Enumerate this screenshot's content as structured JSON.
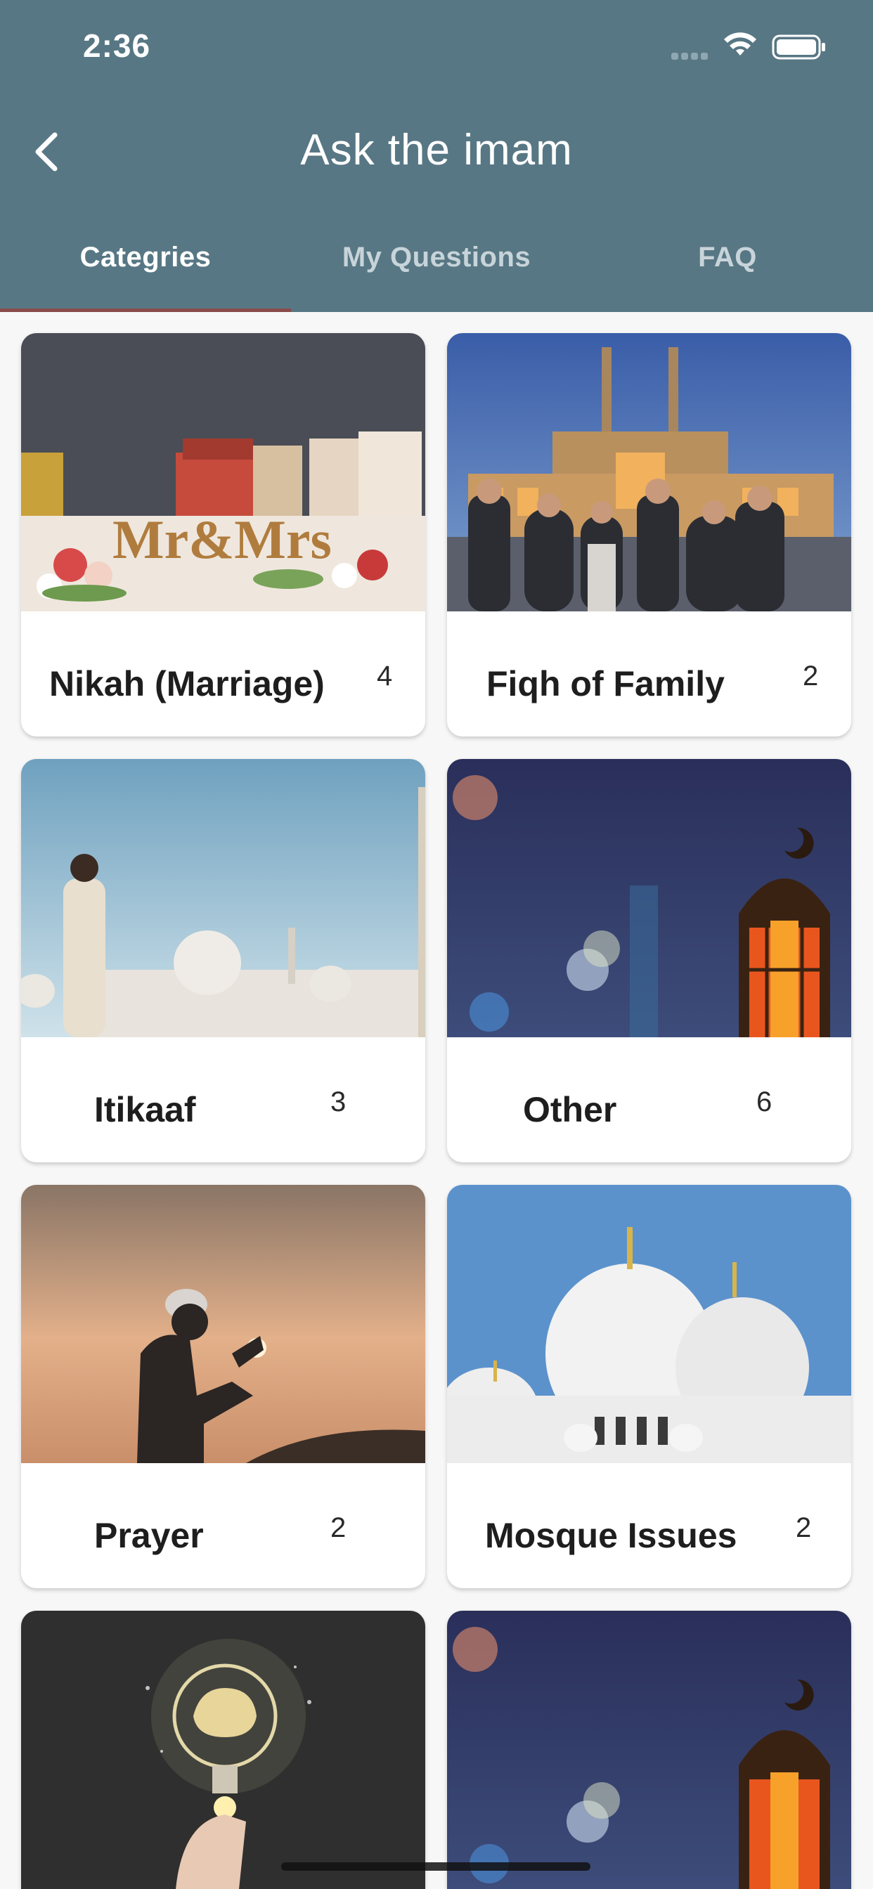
{
  "status_bar": {
    "time": "2:36"
  },
  "header": {
    "title": "Ask the imam"
  },
  "tabs": [
    {
      "label": "Categries",
      "active": true
    },
    {
      "label": "My Questions",
      "active": false
    },
    {
      "label": "FAQ",
      "active": false
    }
  ],
  "categories": [
    {
      "name": "Nikah (Marriage)",
      "count": "4",
      "image": "wedding-table"
    },
    {
      "name": "Fiqh of Family",
      "count": "2",
      "image": "family-at-mosque"
    },
    {
      "name": "Itikaaf",
      "count": "3",
      "image": "man-praying-near-mosque"
    },
    {
      "name": "Other",
      "count": "6",
      "image": "lantern-night"
    },
    {
      "name": "Prayer",
      "count": "2",
      "image": "man-praying-sunset"
    },
    {
      "name": "Mosque Issues",
      "count": "2",
      "image": "white-mosque-domes"
    },
    {
      "name": "",
      "count": "",
      "image": "lightbulb-brain"
    },
    {
      "name": "",
      "count": "",
      "image": "lantern-night"
    }
  ],
  "colors": {
    "appbar": "#587784",
    "tab_indicator": "#8a4b4b"
  }
}
